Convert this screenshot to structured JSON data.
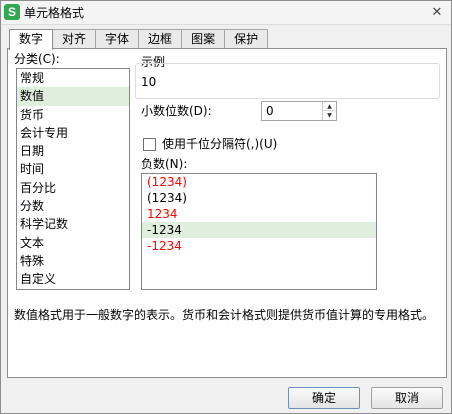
{
  "window": {
    "title": "单元格格式",
    "app_icon_letter": "S",
    "close_glyph": "✕"
  },
  "tabs": [
    {
      "label": "数字",
      "active": true
    },
    {
      "label": "对齐",
      "active": false
    },
    {
      "label": "字体",
      "active": false
    },
    {
      "label": "边框",
      "active": false
    },
    {
      "label": "图案",
      "active": false
    },
    {
      "label": "保护",
      "active": false
    }
  ],
  "category": {
    "label": "分类(C):",
    "items": [
      "常规",
      "数值",
      "货币",
      "会计专用",
      "日期",
      "时间",
      "百分比",
      "分数",
      "科学记数",
      "文本",
      "特殊",
      "自定义"
    ],
    "selected": "数值"
  },
  "sample": {
    "label": "示例",
    "value": "10"
  },
  "decimals": {
    "label": "小数位数(D):",
    "value": "0",
    "up_glyph": "▲",
    "down_glyph": "▼"
  },
  "thousands": {
    "label": "使用千位分隔符(,)(U)",
    "checked": false
  },
  "negative": {
    "label": "负数(N):",
    "items": [
      {
        "text": "(1234)",
        "color": "#ff0000"
      },
      {
        "text": "(1234)",
        "color": "#000000"
      },
      {
        "text": "1234",
        "color": "#ff0000"
      },
      {
        "text": "-1234",
        "color": "#000000"
      },
      {
        "text": "-1234",
        "color": "#ff0000"
      }
    ],
    "selected": "-1234"
  },
  "description": "数值格式用于一般数字的表示。货币和会计格式则提供货币值计算的专用格式。",
  "buttons": {
    "ok": "确定",
    "cancel": "取消"
  }
}
